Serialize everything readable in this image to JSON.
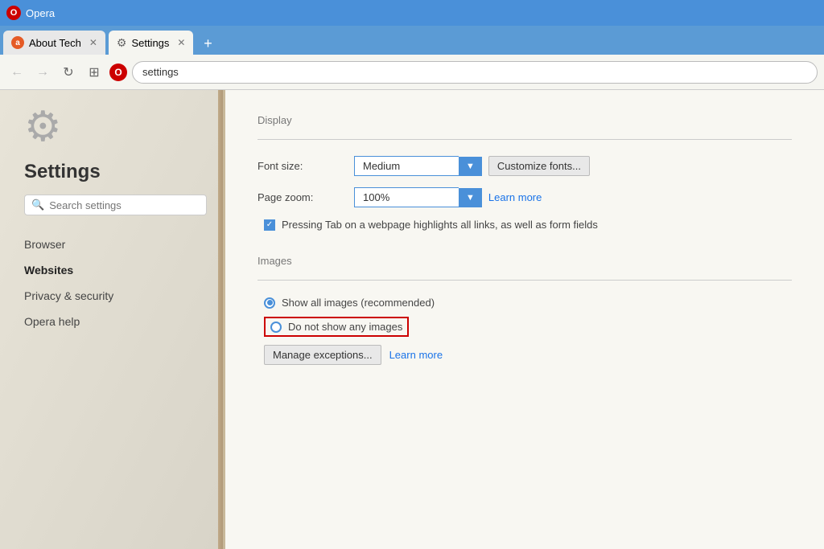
{
  "titlebar": {
    "logo": "O",
    "title": "Opera"
  },
  "tabs": [
    {
      "id": "about-tech",
      "label": "About Tech",
      "icon_type": "a",
      "active": false
    },
    {
      "id": "settings",
      "label": "Settings",
      "icon_type": "gear",
      "active": true
    }
  ],
  "addressbar": {
    "back_icon": "←",
    "forward_icon": "→",
    "refresh_icon": "↻",
    "grid_icon": "⊞",
    "opera_icon": "O",
    "url": "settings"
  },
  "sidebar": {
    "gear_icon": "⚙",
    "title": "Settings",
    "search_placeholder": "Search settings",
    "nav_items": [
      {
        "id": "browser",
        "label": "Browser",
        "active": false
      },
      {
        "id": "websites",
        "label": "Websites",
        "active": true
      },
      {
        "id": "privacy",
        "label": "Privacy & security",
        "active": false
      },
      {
        "id": "help",
        "label": "Opera help",
        "active": false
      }
    ]
  },
  "content": {
    "display": {
      "section_title": "Display",
      "font_size_label": "Font size:",
      "font_size_value": "Medium",
      "customize_label": "Customize fonts...",
      "page_zoom_label": "Page zoom:",
      "page_zoom_value": "100%",
      "learn_more_zoom": "Learn more",
      "tab_highlight_label": "Pressing Tab on a webpage highlights all links, as well as form fields",
      "tab_highlight_checked": true
    },
    "images": {
      "section_title": "Images",
      "show_all_label": "Show all images (recommended)",
      "do_not_show_label": "Do not show any images",
      "manage_label": "Manage exceptions...",
      "learn_more_images": "Learn more"
    }
  }
}
